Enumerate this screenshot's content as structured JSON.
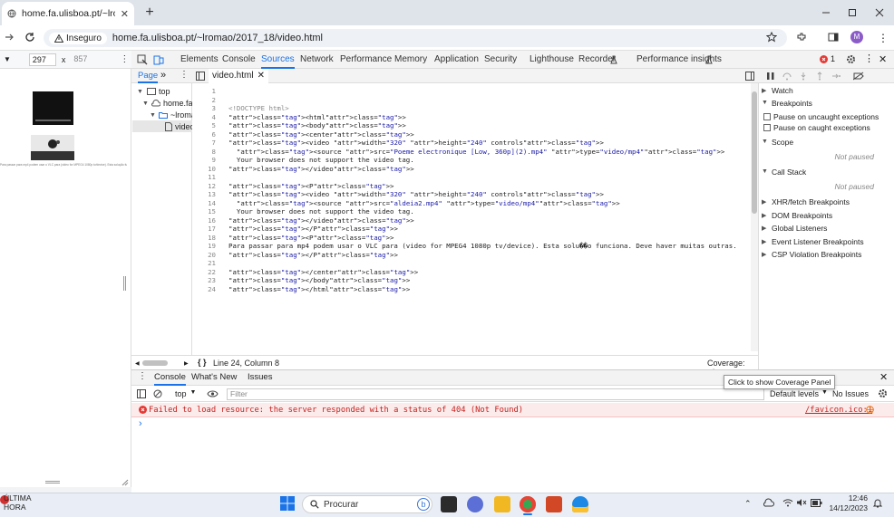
{
  "browser": {
    "tab_title": "home.fa.ulisboa.pt/~lromao/20",
    "security_label": "Inseguro",
    "url": "home.fa.ulisboa.pt/~lromao/2017_18/video.html",
    "profile_initial": "M"
  },
  "device_toolbar": {
    "width": "297",
    "x": "x",
    "height": "857"
  },
  "viewport": {
    "tiny_text": "Para passar para mp4 podem usar o VLC para (video for MPEG4 1080p tv/device). Esta solução funciona. Deve haver muitas outras."
  },
  "devtools": {
    "tabs": [
      "Elements",
      "Console",
      "Sources",
      "Network",
      "Performance",
      "Memory",
      "Application",
      "Security",
      "Lighthouse",
      "Recorder",
      "Performance insights"
    ],
    "active_tab": "Sources",
    "error_count": "1",
    "navigator": {
      "page_tab": "Page",
      "more": "»",
      "tree": [
        "top",
        "home.fa.ul",
        "~lromao",
        "video"
      ]
    },
    "editor": {
      "file_tab": "video.html",
      "lines": [
        "",
        "",
        "<!DOCTYPE html>",
        "<html>",
        "<body>",
        "<center>",
        "<video width=\"320\" height=\"240\" controls>",
        "  <source src=\"Poeme electronique [Low, 360p](2).mp4\" type=\"video/mp4\">",
        "  Your browser does not support the video tag.",
        "</video>",
        "",
        "<P>",
        "<video width=\"320\" height=\"240\" controls>",
        "  <source src=\"aldeia2.mp4\" type=\"video/mp4\">",
        "  Your browser does not support the video tag.",
        "</video>",
        "</P>",
        "<P>",
        "Para passar para mp4 podem usar o VLC para (video for MPEG4 1080p tv/device). Esta solu��o funciona. Deve haver muitas outras.",
        "</P>",
        "",
        "</center>",
        "</body>",
        "</html>"
      ],
      "status_position": "Line 24, Column 8",
      "coverage": "Coverage: n/a",
      "braces": "{ }"
    },
    "debugger": {
      "watch": "Watch",
      "breakpoints": "Breakpoints",
      "pause_uncaught": "Pause on uncaught exceptions",
      "pause_caught": "Pause on caught exceptions",
      "scope": "Scope",
      "not_paused": "Not paused",
      "call_stack": "Call Stack",
      "xhr": "XHR/fetch Breakpoints",
      "dom": "DOM Breakpoints",
      "global": "Global Listeners",
      "event": "Event Listener Breakpoints",
      "csp": "CSP Violation Breakpoints"
    },
    "drawer": {
      "tabs": [
        "Console",
        "What's New",
        "Issues"
      ],
      "context": "top",
      "filter_placeholder": "Filter",
      "levels": "Default levels",
      "issues": "No Issues",
      "error_message": "Failed to load resource: the server responded with a status of 404 (Not Found)",
      "error_source": "/favicon.ico:1",
      "prompt": "›",
      "tooltip": "Click to show Coverage Panel"
    }
  },
  "taskbar": {
    "weather_title": "ÚLTIMA",
    "weather_sub": "HORA",
    "search_label": "Procurar",
    "time": "12:46",
    "date": "14/12/2023"
  },
  "colors": {
    "accent": "#1a73e8",
    "error_bg": "#fcebeb",
    "error_text": "#c5221f"
  }
}
